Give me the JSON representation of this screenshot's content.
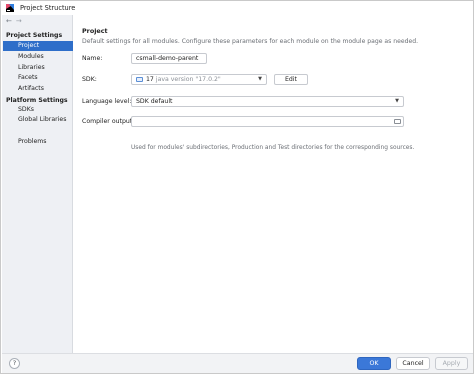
{
  "window": {
    "title": "Project Structure"
  },
  "nav": {
    "back": "←",
    "forward": "→"
  },
  "sidebar": {
    "project_settings_header": "Project Settings",
    "project_settings_items": [
      "Project",
      "Modules",
      "Libraries",
      "Facets",
      "Artifacts"
    ],
    "platform_settings_header": "Platform Settings",
    "platform_settings_items": [
      "SDKs",
      "Global Libraries"
    ],
    "problems": "Problems",
    "selected": "Project"
  },
  "main": {
    "title": "Project",
    "description": "Default settings for all modules. Configure these parameters for each module on the module page as needed.",
    "name_label": "Name:",
    "name_value": "csmall-demo-parent",
    "sdk_label": "SDK:",
    "sdk_version": "17",
    "sdk_detail": "java version \"17.0.2\"",
    "sdk_edit": "Edit",
    "language_level_label": "Language level:",
    "language_level_value": "SDK default",
    "compiler_output_label": "Compiler output:",
    "compiler_output_value": "",
    "compiler_output_hint": "Used for modules' subdirectories, Production and Test directories for the corresponding sources."
  },
  "footer": {
    "help": "?",
    "ok": "OK",
    "cancel": "Cancel",
    "apply": "Apply"
  },
  "colors": {
    "accent": "#2e6ec9",
    "primary_button": "#3b78d8",
    "sidebar_bg": "#eef0f4"
  }
}
